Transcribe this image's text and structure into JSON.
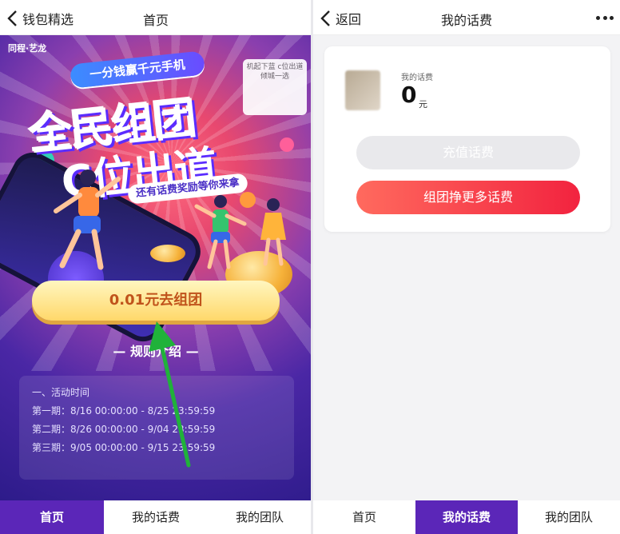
{
  "left_screen": {
    "nav": {
      "back_label": "钱包精选",
      "title": "首页"
    },
    "banner": {
      "brand": "同程·艺龙",
      "pill_text": "一分钱赢千元手机",
      "headline_line1": "全民组团",
      "headline_line2": "C位出道",
      "sub_text": "还有话费奖励等你来拿",
      "corner_ad_text": "机起下蓝 c位出道 倾城一选"
    },
    "cta_label": "0.01元去组团",
    "rules_title": "— 规则介绍 —",
    "rules": {
      "heading": "一、活动时间",
      "periods": [
        "第一期：8/16 00:00:00 - 8/25 23:59:59",
        "第二期：8/26 00:00:00 - 9/04 23:59:59",
        "第三期：9/05 00:00:00 - 9/15 23:59:59"
      ]
    },
    "tabs": [
      "首页",
      "我的话费",
      "我的团队"
    ],
    "active_tab": 0,
    "accent_color": "#5b26b8"
  },
  "right_screen": {
    "nav": {
      "back_label": "返回",
      "title": "我的话费"
    },
    "balance": {
      "label": "我的话费",
      "value": "0",
      "unit": "元"
    },
    "recharge_button": "充值话费",
    "group_button": "组团挣更多话费",
    "tabs": [
      "首页",
      "我的话费",
      "我的团队"
    ],
    "active_tab": 1,
    "button_gradient": [
      "#ff6a5e",
      "#f2233f"
    ]
  }
}
